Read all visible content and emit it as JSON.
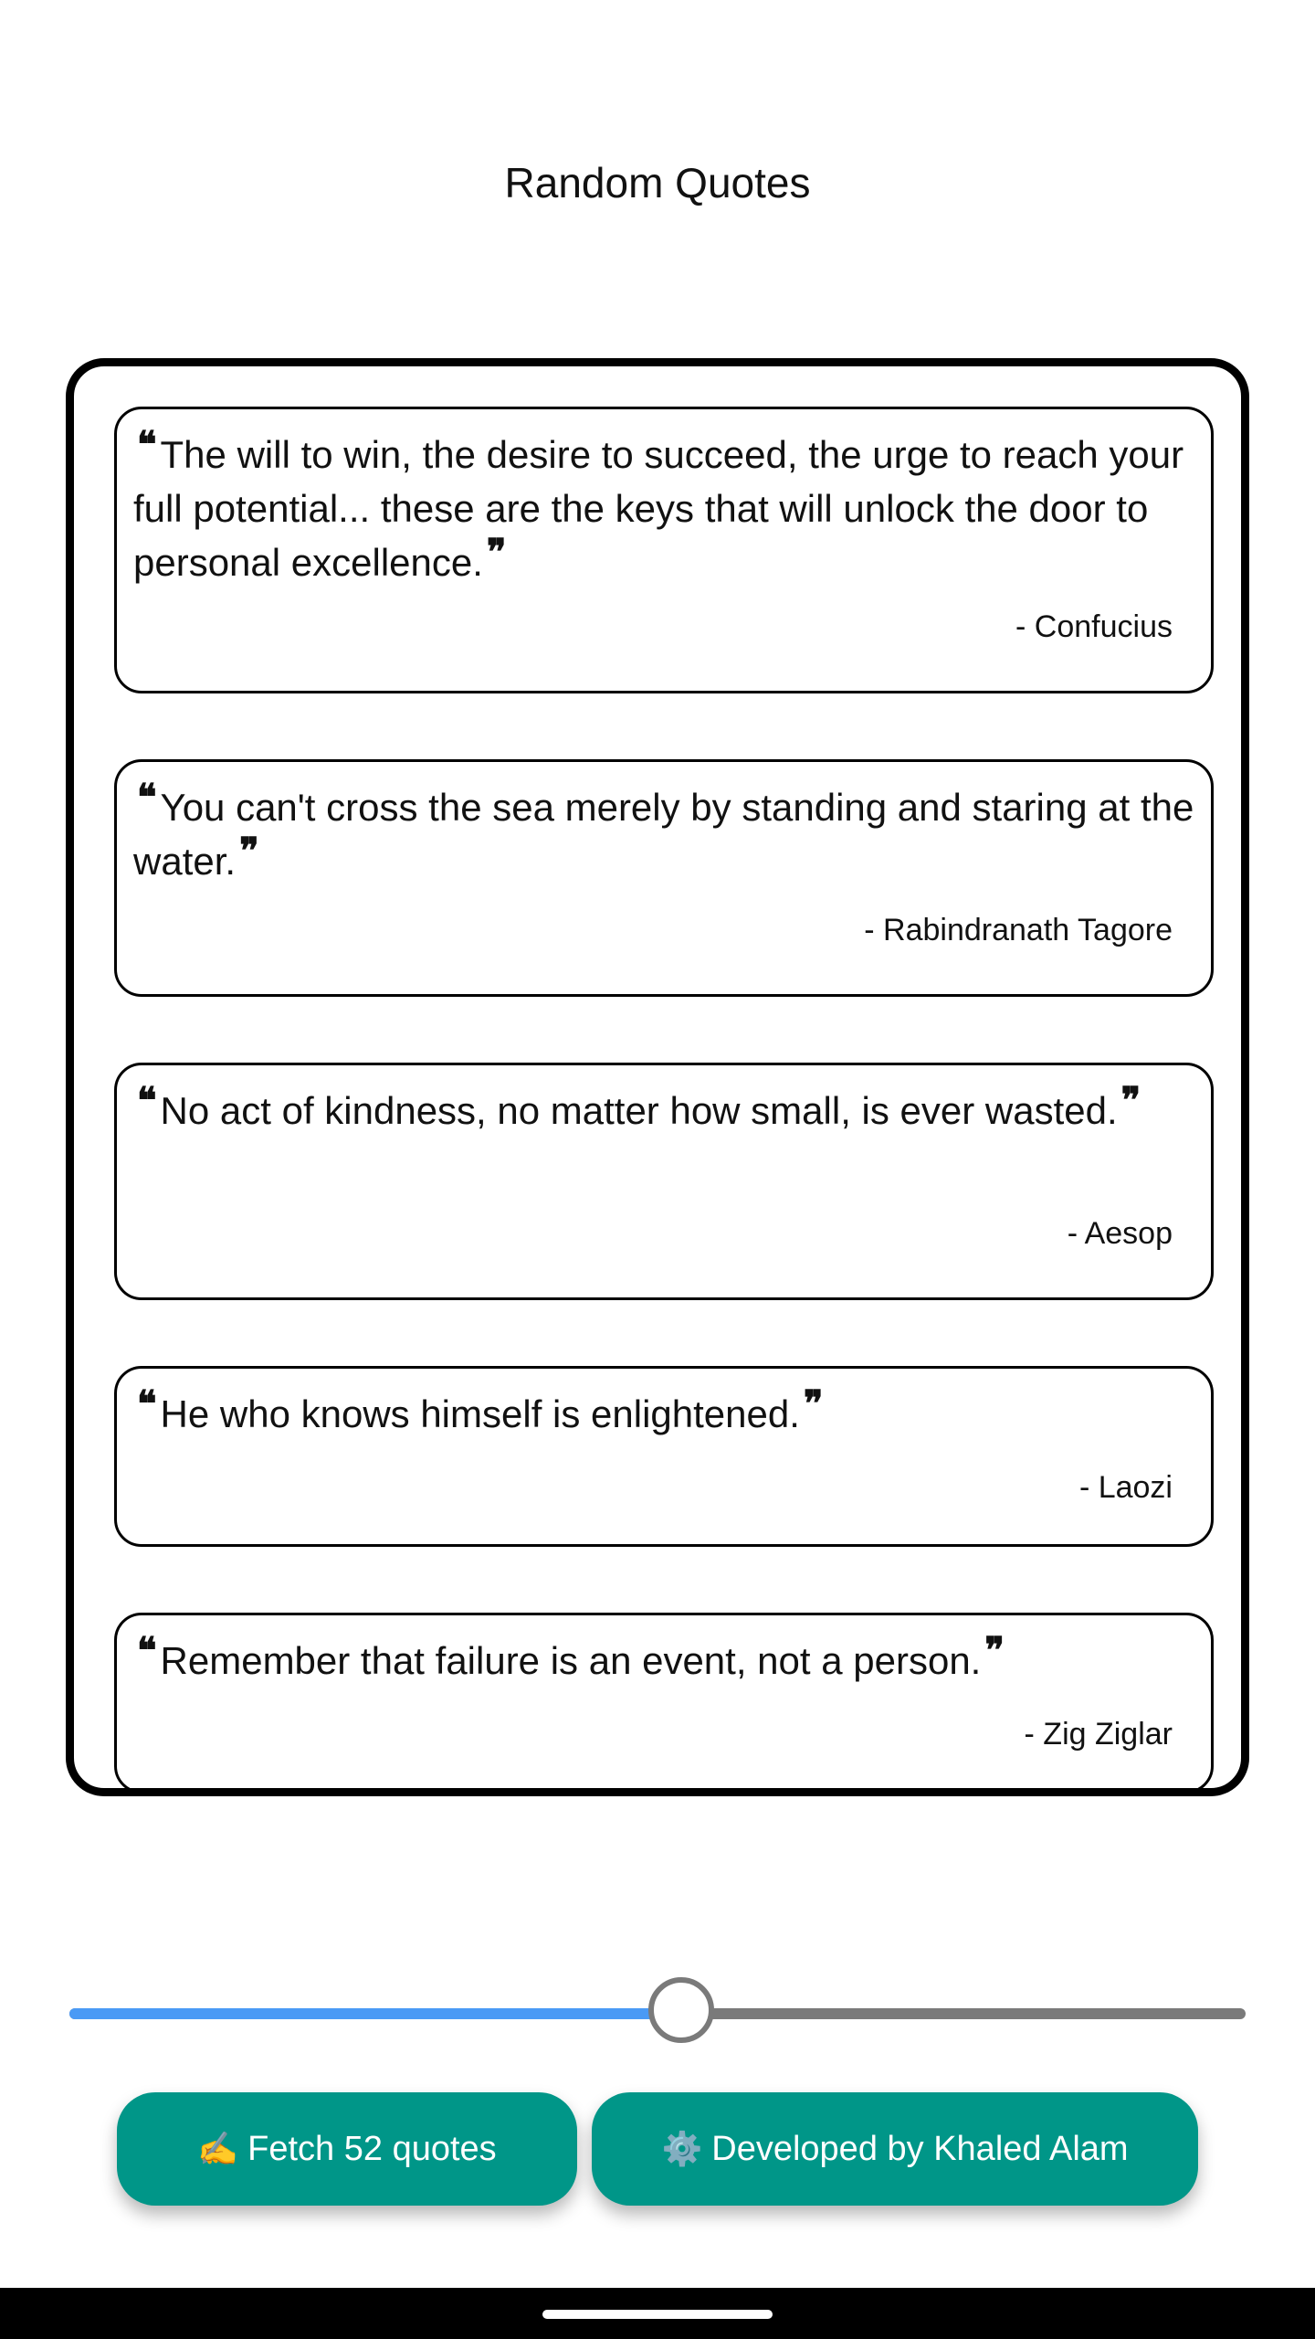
{
  "app": {
    "title": "Random Quotes"
  },
  "quotes": [
    {
      "text": "The will to win, the desire to succeed, the urge to reach your full potential... these are the keys that will unlock the door to personal excellence.",
      "author": "- Confucius"
    },
    {
      "text": "You can't cross the sea merely by standing and staring at the water.",
      "author": "- Rabindranath Tagore"
    },
    {
      "text": "No act of kindness, no matter how small, is ever wasted.",
      "author": "- Aesop"
    },
    {
      "text": "He who knows himself is enlightened.",
      "author": "- Laozi"
    },
    {
      "text": "Remember that failure is an event, not a person.",
      "author": "- Zig Ziglar"
    }
  ],
  "quote_marks": {
    "open": "❝",
    "close": "❞"
  },
  "slider": {
    "value": 52,
    "max": 100,
    "active_color": "#4a9af5",
    "inactive_color": "#7a7a7a"
  },
  "buttons": {
    "fetch": {
      "icon": "✍️",
      "label": "Fetch 52 quotes"
    },
    "developer": {
      "icon": "⚙️",
      "label": "Developed by Khaled Alam"
    },
    "color": "#009688"
  }
}
